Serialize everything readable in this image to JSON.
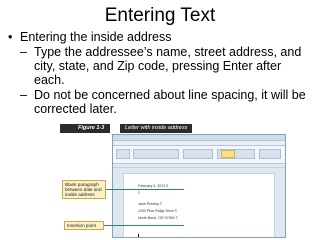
{
  "slide": {
    "title": "Entering Text",
    "bullets": [
      {
        "text": "Entering the inside address",
        "sub": [
          "Type the addressee’s name, street address, and city, state, and Zip code, pressing Enter after each.",
          "Do not be concerned about line spacing, it will be corrected later."
        ]
      }
    ]
  },
  "figure": {
    "tag": "Figure 1-3",
    "caption": "Letter with inside address",
    "document_lines": [
      "February 4, 2013",
      "",
      "Jane Presley",
      "1250 Pine Ridge Drive",
      "North Bend, OR 97459"
    ],
    "paragraph_mark": "¶",
    "callouts": {
      "blank_paragraph": "Blank paragraph between date and inside address",
      "insertion_point": "Insertion point"
    }
  }
}
